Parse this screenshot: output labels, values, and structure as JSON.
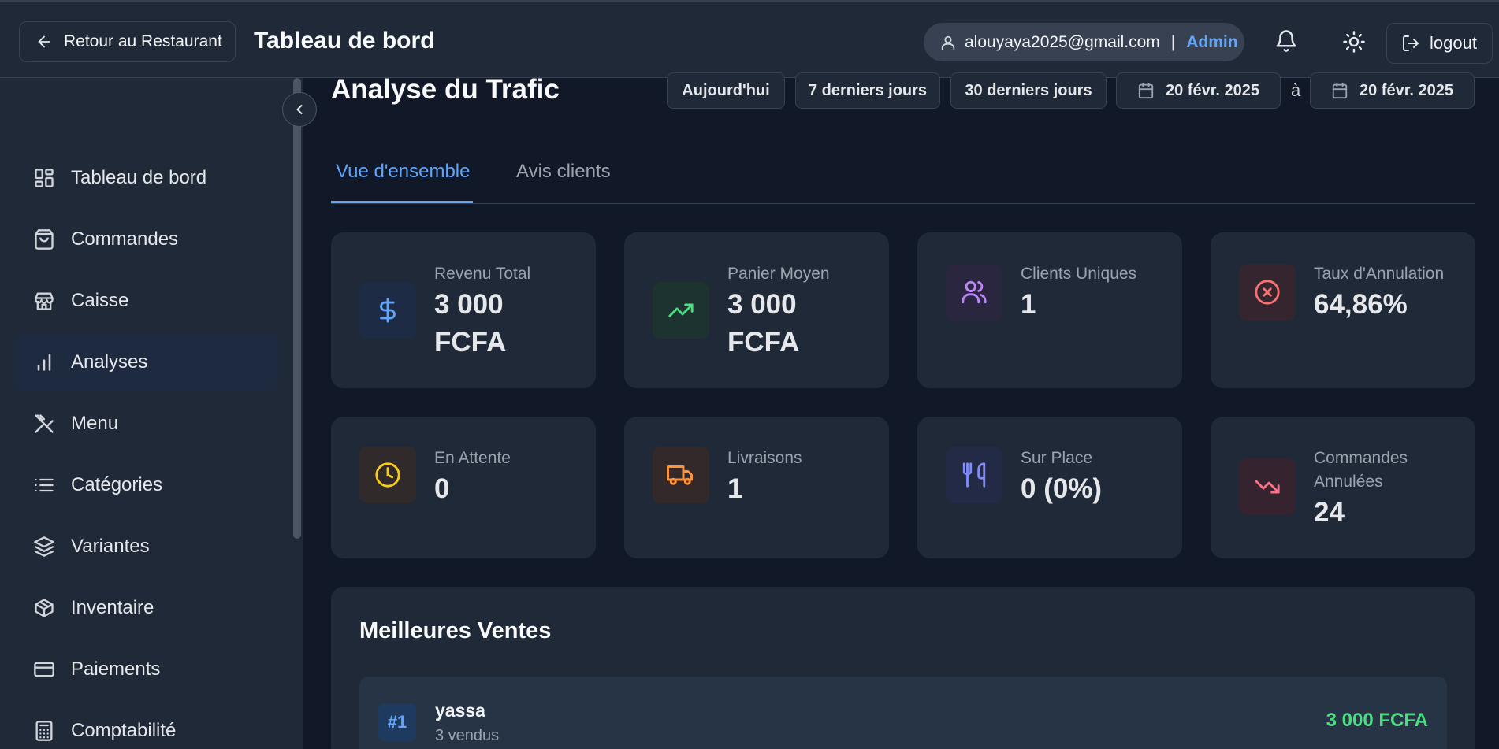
{
  "header": {
    "back_label": "Retour au Restaurant",
    "title": "Tableau de bord",
    "user_email": "alouyaya2025@gmail.com",
    "separator": "|",
    "user_role": "Admin",
    "logout_label": "logout"
  },
  "sidebar": {
    "items": [
      {
        "label": "Tableau de bord",
        "icon": "layout-grid-icon"
      },
      {
        "label": "Commandes",
        "icon": "shopping-bag-icon"
      },
      {
        "label": "Caisse",
        "icon": "store-icon"
      },
      {
        "label": "Analyses",
        "icon": "bar-chart-icon",
        "active": true
      },
      {
        "label": "Menu",
        "icon": "utensils-crossed-icon"
      },
      {
        "label": "Catégories",
        "icon": "list-icon"
      },
      {
        "label": "Variantes",
        "icon": "layers-icon"
      },
      {
        "label": "Inventaire",
        "icon": "package-icon"
      },
      {
        "label": "Paiements",
        "icon": "credit-card-icon"
      },
      {
        "label": "Comptabilité",
        "icon": "calculator-icon"
      }
    ]
  },
  "main": {
    "title": "Analyse du Trafic",
    "ranges": {
      "today": "Aujourd'hui",
      "last7": "7 derniers jours",
      "last30": "30 derniers jours",
      "start_date": "20 févr. 2025",
      "to": "à",
      "end_date": "20 févr. 2025"
    },
    "tabs": [
      {
        "label": "Vue d'ensemble",
        "active": true
      },
      {
        "label": "Avis clients",
        "active": false
      }
    ],
    "stats": [
      {
        "label": "Revenu Total",
        "value_line1": "3 000",
        "value_line2": "FCFA",
        "icon": "dollar-icon",
        "color": "#60a5fa"
      },
      {
        "label": "Panier Moyen",
        "value_line1": "3 000",
        "value_line2": "FCFA",
        "icon": "trending-up-icon",
        "color": "#4ade80"
      },
      {
        "label": "Clients Uniques",
        "value_line1": "1",
        "icon": "users-icon",
        "color": "#c084fc"
      },
      {
        "label": "Taux d'Annulation",
        "value_line1": "64,86%",
        "icon": "x-circle-icon",
        "color": "#f87171"
      },
      {
        "label": "En Attente",
        "value_line1": "0",
        "icon": "clock-icon",
        "color": "#facc15"
      },
      {
        "label": "Livraisons",
        "value_line1": "1",
        "icon": "truck-icon",
        "color": "#fb923c"
      },
      {
        "label": "Sur Place",
        "value_line1": "0 (0%)",
        "icon": "utensils-icon",
        "color": "#818cf8"
      },
      {
        "label_line1": "Commandes",
        "label_line2": "Annulées",
        "value_line1": "24",
        "icon": "trending-down-icon",
        "color": "#fb7185"
      }
    ],
    "best_sellers": {
      "title": "Meilleures Ventes",
      "items": [
        {
          "rank": "#1",
          "name": "yassa",
          "sold": "3 vendus",
          "amount": "3 000 FCFA"
        }
      ]
    }
  }
}
